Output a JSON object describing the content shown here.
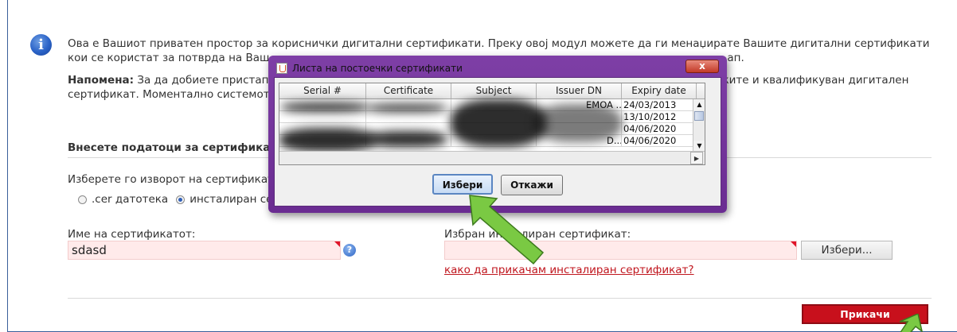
{
  "intro": {
    "line1": "Ова е Вашиот приватен простор за кориснички дигитални сертификати. Преку овој модул можете да ги менаџирате Вашите дигитални сертификати",
    "line2": "кои се користат за потврда на Ваш",
    "line2_tail": "ап."
  },
  "note": {
    "label": "Напомена:",
    "text_start": " За да добиете пристап",
    "text_end": "ките и квалификуван дигитален",
    "line2": "сертификат. Моментално системот"
  },
  "form": {
    "section_title": "Внесете податоци за сертификат",
    "source_label": "Изберете го изворот на сертификатот",
    "radio_file": ".cer датотека",
    "radio_installed": "инсталиран се",
    "name_label": "Име на сертификатот:",
    "name_value": "sdasd",
    "picked_label": "Избран инсталиран сертификат:",
    "choose_button": "Избери...",
    "help_link": "како да прикачам инсталиран сертификат?",
    "attach_button": "Прикачи"
  },
  "dialog": {
    "title": "Листа на постоечки сертификати",
    "close": "x",
    "columns": [
      "Serial #",
      "Certificate",
      "Subject",
      "Issuer DN",
      "Expiry date"
    ],
    "rows": [
      {
        "issuer": "EMOA ...",
        "expiry": "24/03/2013"
      },
      {
        "issuer": "",
        "expiry": "13/10/2012"
      },
      {
        "issuer": "",
        "expiry": "04/06/2020"
      },
      {
        "issuer": "D...",
        "expiry": "04/06/2020"
      }
    ],
    "select_button": "Избери",
    "cancel_button": "Откажи"
  },
  "colors": {
    "accent_red": "#c8101c",
    "link_red": "#c0161e",
    "dialog_frame": "#6a2c91",
    "arrow_green": "#7ac943"
  }
}
